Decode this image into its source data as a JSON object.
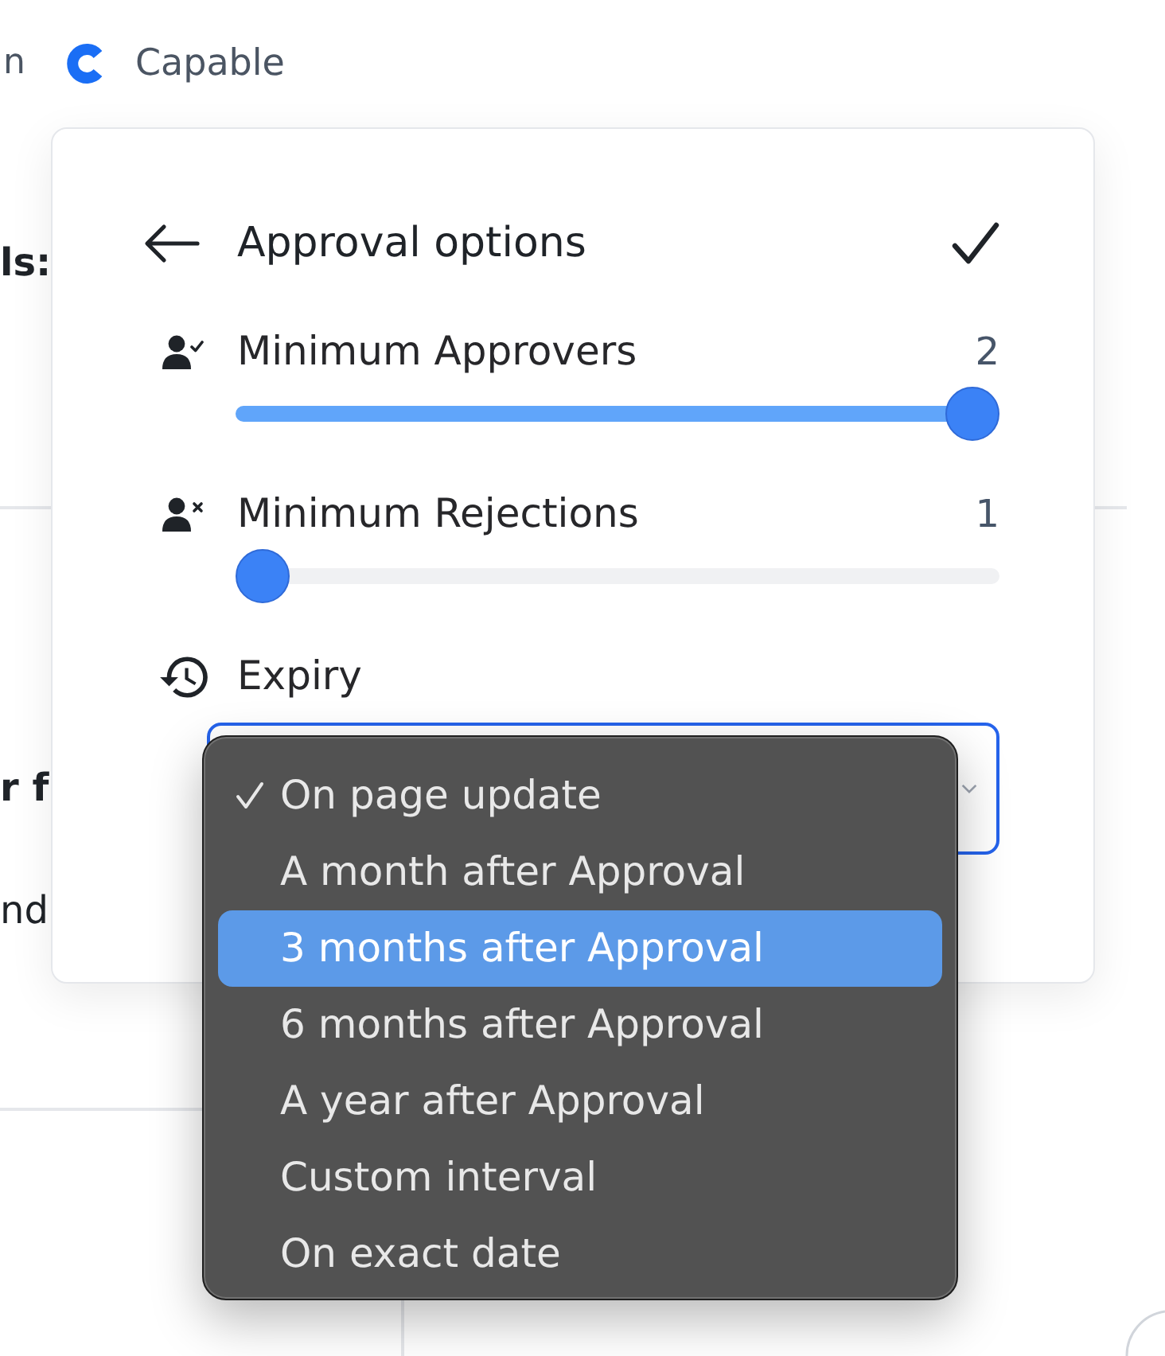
{
  "background": {
    "top_bar": {
      "nav_fragment": "n",
      "brand": "Capable"
    },
    "upper_section": {
      "fragment": {
        "text": "ls:",
        "bold": true
      }
    },
    "lower_section": {
      "fragments": [
        {
          "text": "r f",
          "bold": true
        },
        {
          "text": "nd",
          "bold": false
        }
      ]
    }
  },
  "approval_options": {
    "title": "Approval options",
    "settings": [
      {
        "kind": "slider",
        "label": "Minimum Approvers",
        "value": "2",
        "level": 1
      },
      {
        "kind": "slider",
        "label": "Minimum Rejections",
        "value": "1",
        "level": 0
      },
      {
        "kind": "select",
        "label": "Expiry"
      }
    ]
  },
  "expiry_menu": {
    "options": [
      {
        "label": "On page update",
        "checked": true,
        "highlighted": false
      },
      {
        "label": "A month after Approval",
        "checked": false,
        "highlighted": false
      },
      {
        "label": "3 months after Approval",
        "checked": false,
        "highlighted": true
      },
      {
        "label": "6 months after Approval",
        "checked": false,
        "highlighted": false
      },
      {
        "label": "A year after Approval",
        "checked": false,
        "highlighted": false
      },
      {
        "label": "Custom interval",
        "checked": false,
        "highlighted": false
      },
      {
        "label": "On exact date",
        "checked": false,
        "highlighted": false
      }
    ]
  }
}
